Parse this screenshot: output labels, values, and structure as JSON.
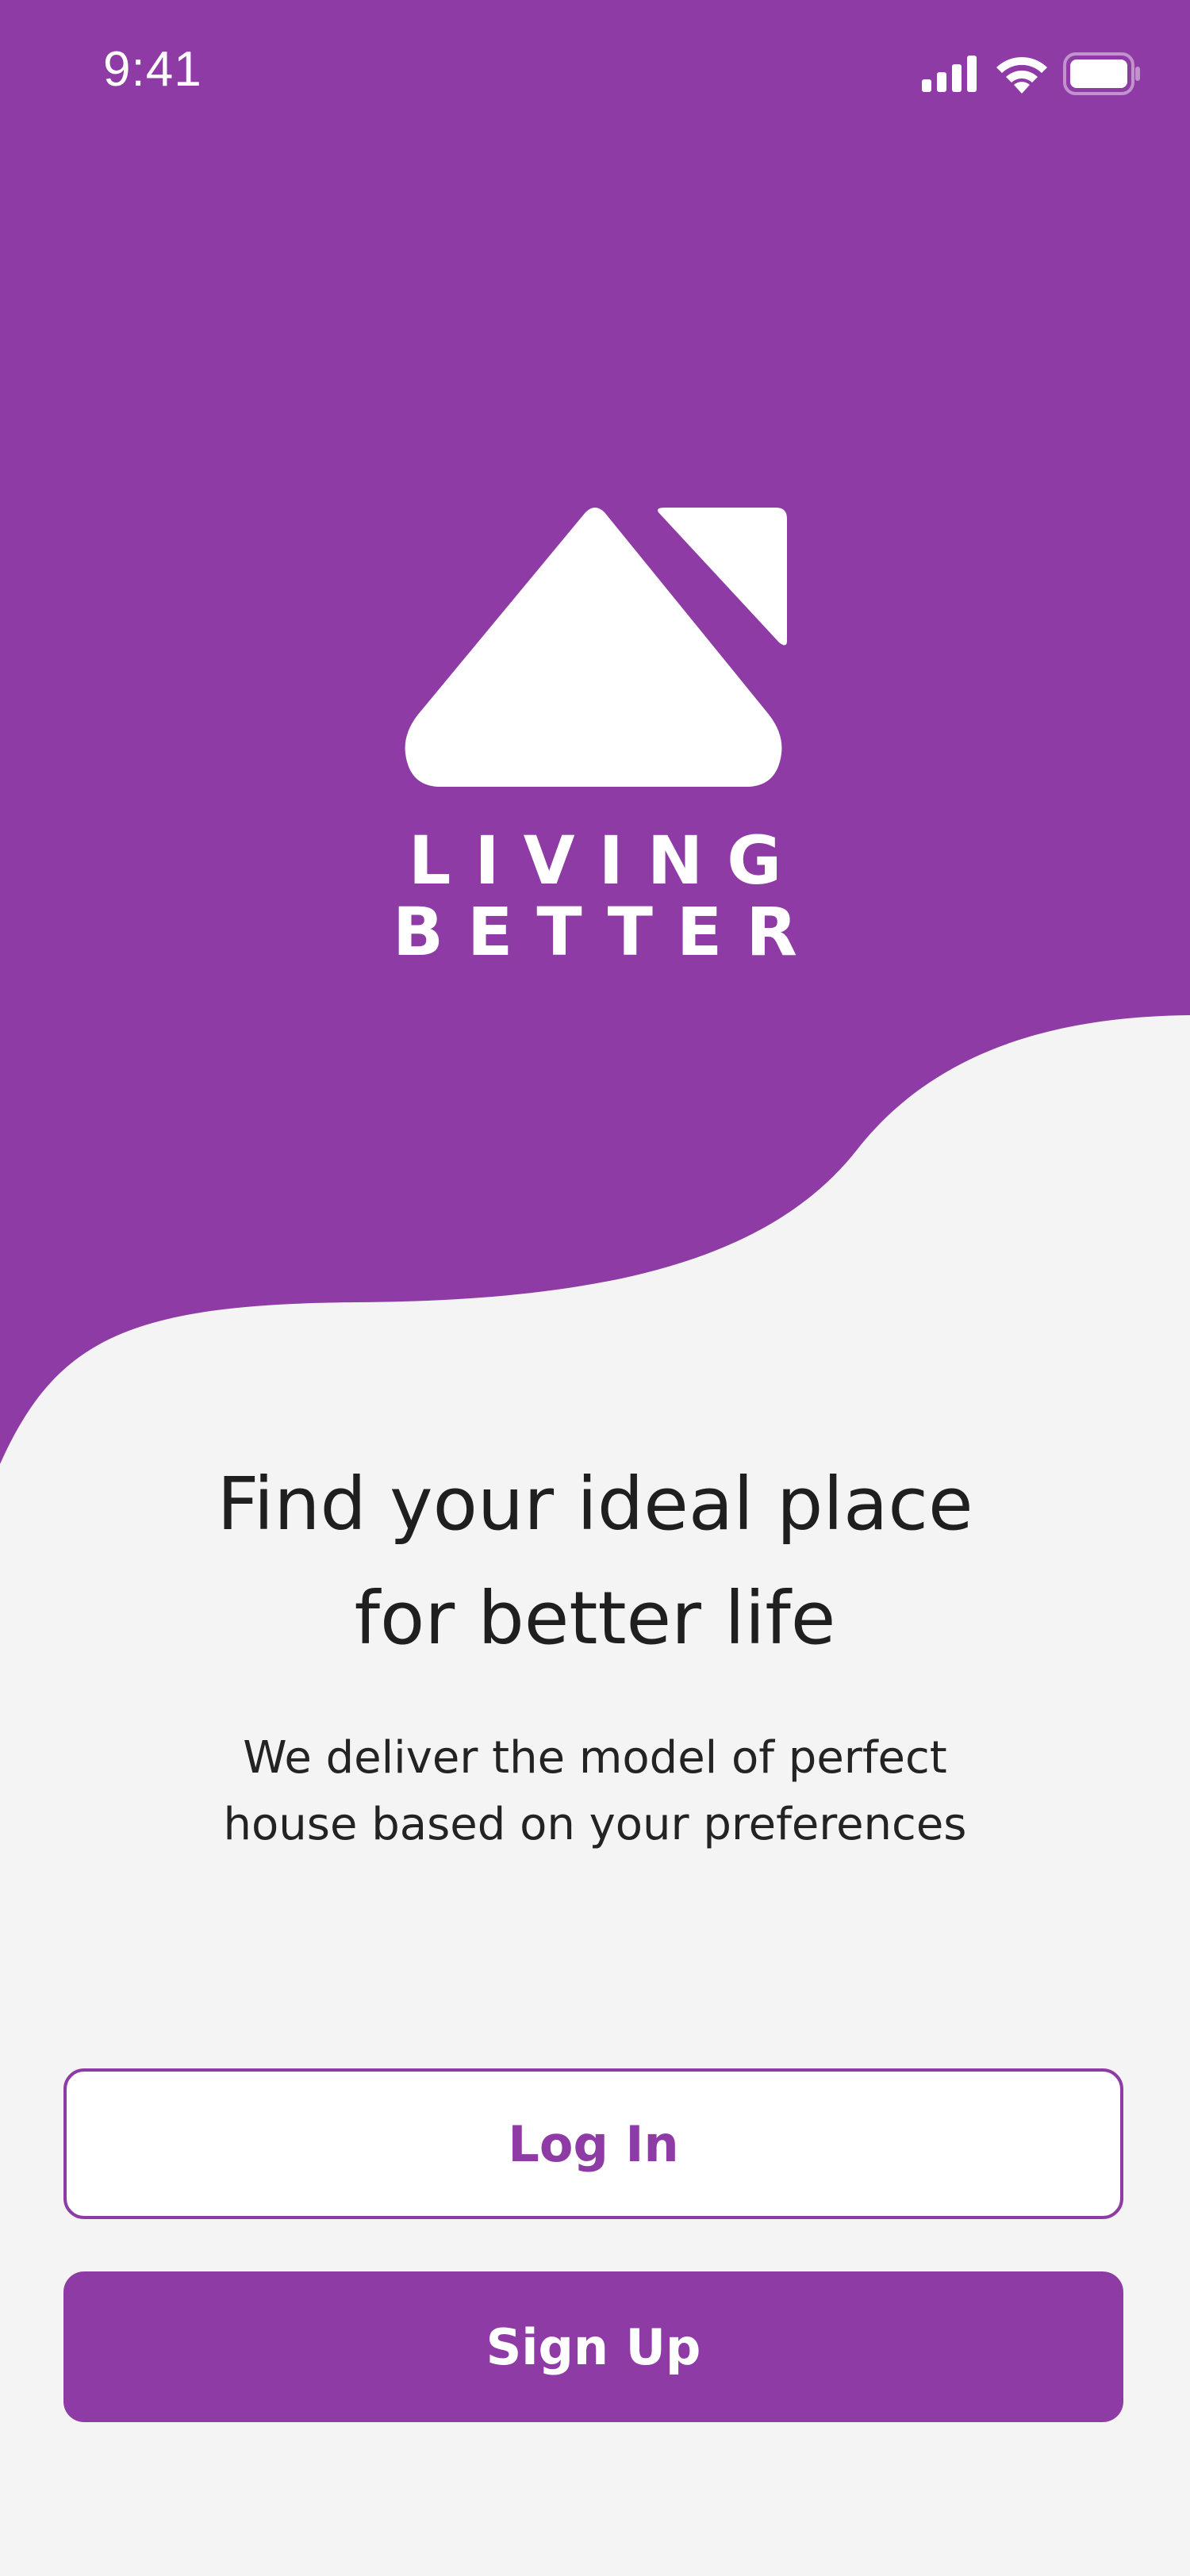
{
  "theme": {
    "brand_color": "#8f3ba5",
    "background": "#f4f4f4",
    "text_color": "#1f1f1f"
  },
  "status_bar": {
    "time": "9:41",
    "icons": [
      "signal-icon",
      "wifi-icon",
      "battery-icon"
    ]
  },
  "brand": {
    "logo_icon": "house-roof-icon",
    "line1": "LIVING",
    "line2": "BETTER"
  },
  "hero": {
    "headline_line1": "Find your ideal place",
    "headline_line2": "for better life",
    "subtitle_line1": "We deliver the model of perfect",
    "subtitle_line2": "house based on your preferences"
  },
  "actions": {
    "login_label": "Log In",
    "signup_label": "Sign Up"
  }
}
